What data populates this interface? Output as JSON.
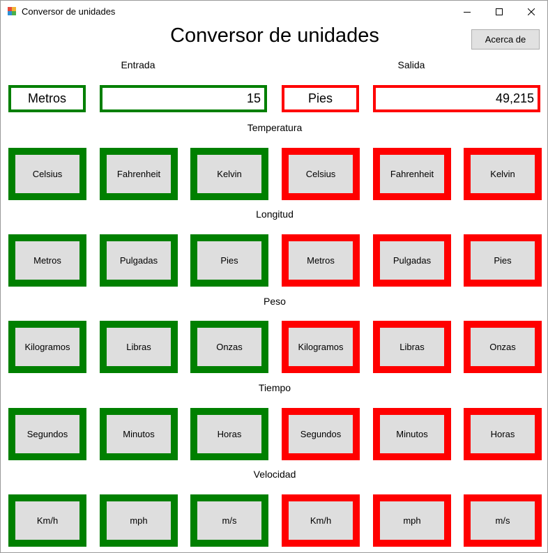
{
  "window": {
    "title": "Conversor de unidades",
    "controls": {
      "minimize": "minimize-icon",
      "maximize": "maximize-icon",
      "close": "close-icon"
    }
  },
  "header": {
    "title": "Conversor de unidades",
    "about_label": "Acerca de"
  },
  "input": {
    "label": "Entrada",
    "unit": "Metros",
    "value": "15"
  },
  "output": {
    "label": "Salida",
    "unit": "Pies",
    "value": "49,215"
  },
  "colors": {
    "input_accent": "#008000",
    "output_accent": "#ff0000",
    "button_face": "#dedede"
  },
  "sections": [
    {
      "label": "Temperatura",
      "units": [
        "Celsius",
        "Fahrenheit",
        "Kelvin"
      ]
    },
    {
      "label": "Longitud",
      "units": [
        "Metros",
        "Pulgadas",
        "Pies"
      ]
    },
    {
      "label": "Peso",
      "units": [
        "Kilogramos",
        "Libras",
        "Onzas"
      ]
    },
    {
      "label": "Tiempo",
      "units": [
        "Segundos",
        "Minutos",
        "Horas"
      ]
    },
    {
      "label": "Velocidad",
      "units": [
        "Km/h",
        "mph",
        "m/s"
      ]
    }
  ]
}
